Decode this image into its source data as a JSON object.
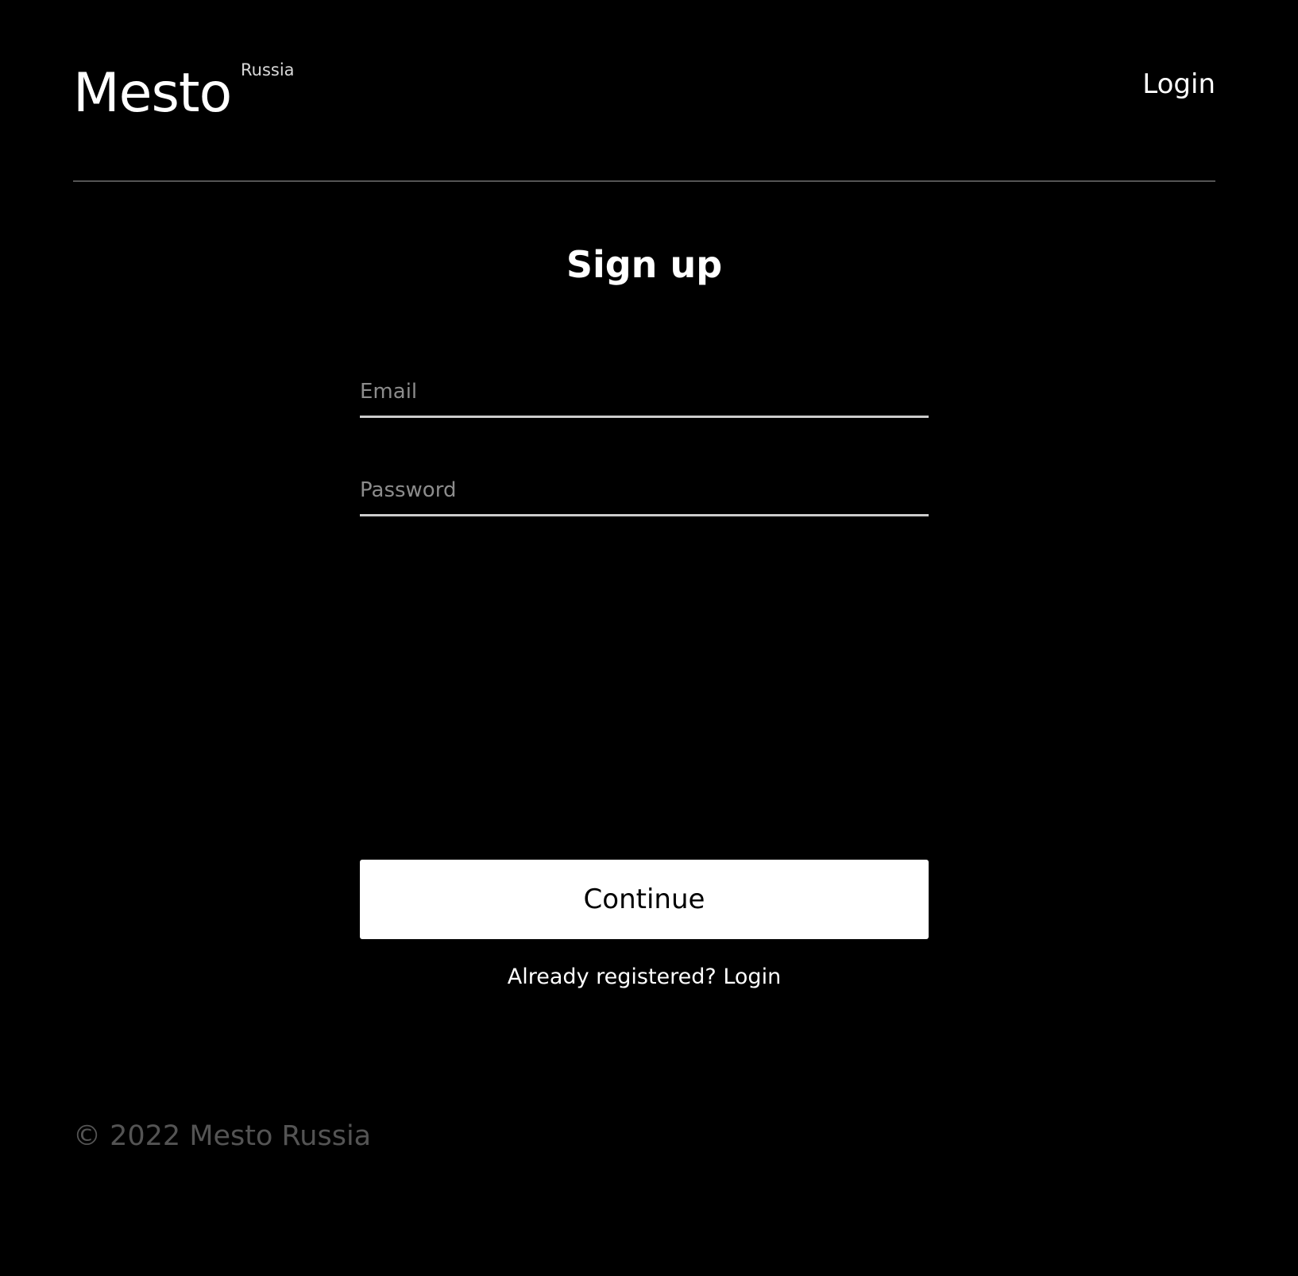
{
  "header": {
    "logo_text": "Mesto",
    "logo_subtext": "Russia",
    "login_link": "Login"
  },
  "form": {
    "title": "Sign up",
    "email": {
      "value": "",
      "placeholder": "Email"
    },
    "password": {
      "value": "",
      "placeholder": "Password"
    },
    "submit_label": "Continue",
    "already_prompt": "Already registered?",
    "already_link": "Login"
  },
  "footer": {
    "copyright": "© 2022 Mesto Russia"
  },
  "colors": {
    "background": "#000000",
    "text": "#ffffff",
    "placeholder": "#8c8c8c",
    "footer_text": "#545454",
    "button_bg": "#ffffff",
    "button_text": "#000000"
  }
}
